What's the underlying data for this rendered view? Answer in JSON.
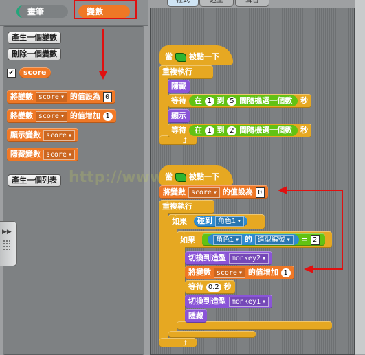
{
  "categories": {
    "pen_label": "畫筆",
    "variables_label": "變數",
    "pen_color": "#21a67a",
    "variables_color": "#ef7826"
  },
  "palette": {
    "make_variable": "產生一個變數",
    "delete_variable": "刪除一個變數",
    "variable_name": "score",
    "variable_checked": true,
    "blocks": {
      "set_prefix": "將變數",
      "set_suffix": "的值設為",
      "set_value": "0",
      "change_prefix": "將變數",
      "change_suffix": "的值增加",
      "change_value": "1",
      "show_var": "顯示變數",
      "hide_var": "隱藏變數",
      "var_dropdown": "score"
    },
    "make_list": "產生一個列表"
  },
  "tabs": [
    "程式",
    "造型",
    "聲音"
  ],
  "watermark": "http://www.            le.cn",
  "script1": {
    "hat_prefix": "當",
    "hat_suffix": "被點一下",
    "forever": "重複執行",
    "hide": "隱藏",
    "wait": "等待",
    "wait_suffix": "秒",
    "pick_prefix": "在",
    "pick_mid": "到",
    "pick_suffix": "間隨機選一個數",
    "wait1_from": "1",
    "wait1_to": "5",
    "show": "顯示",
    "wait2_from": "1",
    "wait2_to": "2",
    "loop_arrow": "⮥"
  },
  "script2": {
    "hat_prefix": "當",
    "hat_suffix": "被點一下",
    "set_prefix": "將變數",
    "set_var": "score",
    "set_suffix": "的值設為",
    "set_value": "0",
    "forever": "重複執行",
    "if1": "如果",
    "touching": "碰到",
    "touching_target": "角色1",
    "if2": "如果",
    "sensor_sprite": "角色1",
    "of_label": "的",
    "sensor_attr": "造型編號",
    "equals": "=",
    "equals_value": "2",
    "switch1_label": "切換到造型",
    "switch1_costume": "monkey2",
    "change_prefix": "將變數",
    "change_var": "score",
    "change_suffix": "的值增加",
    "change_value": "1",
    "wait": "等待",
    "wait_value": "0.2",
    "wait_suffix": "秒",
    "switch2_label": "切換到造型",
    "switch2_costume": "monkey1",
    "hide": "隱藏",
    "loop_arrow": "⮥"
  },
  "annotation_color": "#e01010"
}
